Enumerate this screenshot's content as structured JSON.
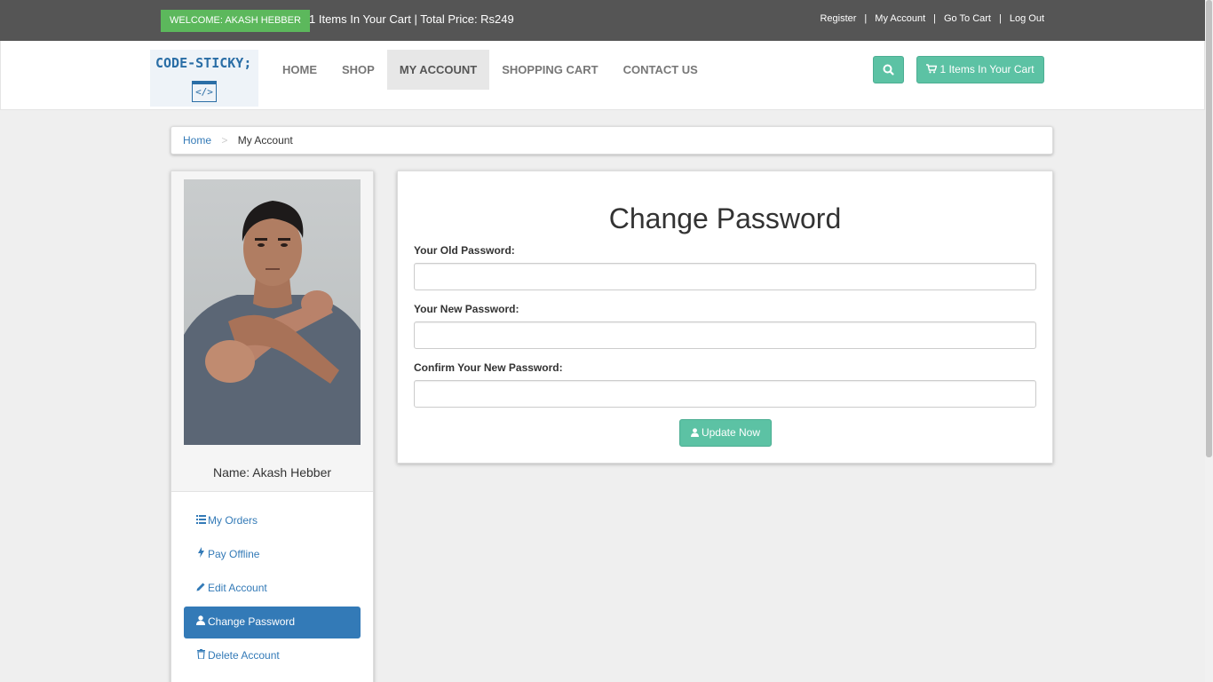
{
  "topbar": {
    "welcome": "WELCOME: AKASH HEBBER",
    "cart_summary": "1 Items In Your Cart | Total Price: Rs249",
    "links": [
      "Register",
      "My Account",
      "Go To Cart",
      "Log Out"
    ],
    "separator": "|"
  },
  "navbar": {
    "logo_text": "CODE-STICKY;",
    "logo_icon": "</>",
    "items": [
      "HOME",
      "SHOP",
      "MY ACCOUNT",
      "SHOPPING CART",
      "CONTACT US"
    ],
    "active_item": "MY ACCOUNT",
    "search_icon": "search-icon",
    "cart_button": "1 Items In Your Cart"
  },
  "breadcrumb": {
    "home": "Home",
    "separator": ">",
    "current": "My Account"
  },
  "sidebar": {
    "name": "Name: Akash Hebber",
    "menu": [
      {
        "label": "My Orders",
        "icon": "list-icon"
      },
      {
        "label": "Pay Offline",
        "icon": "bolt-icon"
      },
      {
        "label": "Edit Account",
        "icon": "pencil-icon"
      },
      {
        "label": "Change Password",
        "icon": "user-icon"
      },
      {
        "label": "Delete Account",
        "icon": "trash-icon"
      }
    ],
    "active_item": "Change Password"
  },
  "form": {
    "title": "Change Password",
    "old_label": "Your Old Password:",
    "old_value": "",
    "new_label": "Your New Password:",
    "new_value": "",
    "confirm_label": "Confirm Your New Password:",
    "confirm_value": "",
    "button": "Update Now"
  },
  "colors": {
    "topbar": "#555555",
    "welcome_badge": "#5cb85c",
    "accent_button": "#5cc2a4",
    "link": "#337ab7",
    "active_menu": "#337ab7"
  }
}
